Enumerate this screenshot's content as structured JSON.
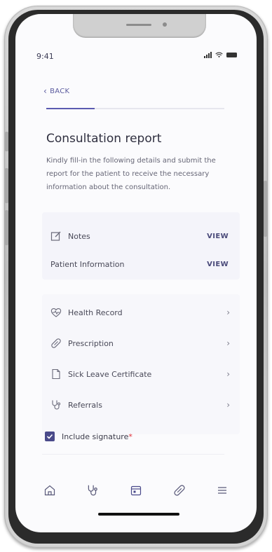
{
  "status_bar": {
    "time": "9:41"
  },
  "nav": {
    "back_label": "BACK",
    "progress_fraction": 0.27
  },
  "header": {
    "title": "Consultation report",
    "description": "Kindly fill-in the following details and submit the report for the patient to receive the necessary information about the consultation."
  },
  "top_card": {
    "notes": {
      "label": "Notes",
      "action": "VIEW",
      "icon": "edit-note-icon"
    },
    "patient_info": {
      "label": "Patient Information",
      "action": "VIEW"
    }
  },
  "list": {
    "items": [
      {
        "label": "Health Record",
        "icon": "heart-pulse-icon"
      },
      {
        "label": "Prescription",
        "icon": "pill-icon"
      },
      {
        "label": "Sick Leave Certificate",
        "icon": "document-icon"
      },
      {
        "label": "Referrals",
        "icon": "stethoscope-icon"
      }
    ]
  },
  "signature": {
    "label": "Include signature",
    "required_mark": "*",
    "checked": true
  },
  "tabbar": {
    "tabs": [
      {
        "icon": "home-icon"
      },
      {
        "icon": "stethoscope-icon"
      },
      {
        "icon": "calendar-icon"
      },
      {
        "icon": "pill-icon"
      },
      {
        "icon": "menu-icon"
      }
    ]
  },
  "colors": {
    "accent": "#4a4a8a",
    "required": "#e0303a",
    "text": "#2f2f3f"
  }
}
